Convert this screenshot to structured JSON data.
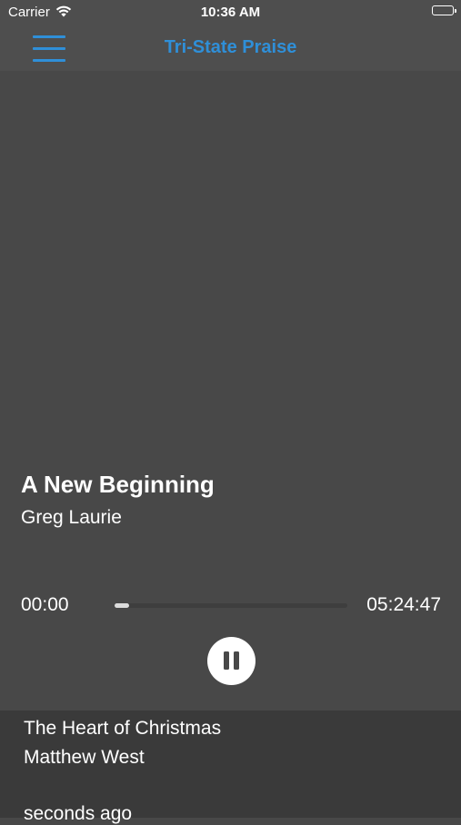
{
  "status_bar": {
    "carrier": "Carrier",
    "time": "10:36 AM",
    "wifi_icon": "wifi-icon",
    "battery_icon": "battery-icon"
  },
  "nav": {
    "title": "Tri-State Praise",
    "menu_icon": "hamburger-menu-icon",
    "accent_color": "#2f8fd8"
  },
  "now_playing": {
    "title": "A New Beginning",
    "artist": "Greg Laurie",
    "elapsed": "00:00",
    "duration": "05:24:47",
    "progress": 0.0,
    "control_icon": "pause-icon"
  },
  "recent": {
    "title": "The Heart of Christmas",
    "artist": "Matthew West",
    "played": "seconds ago"
  },
  "colors": {
    "background": "#484848",
    "header": "#4e4e4e",
    "history_background": "#3a3a3a"
  }
}
